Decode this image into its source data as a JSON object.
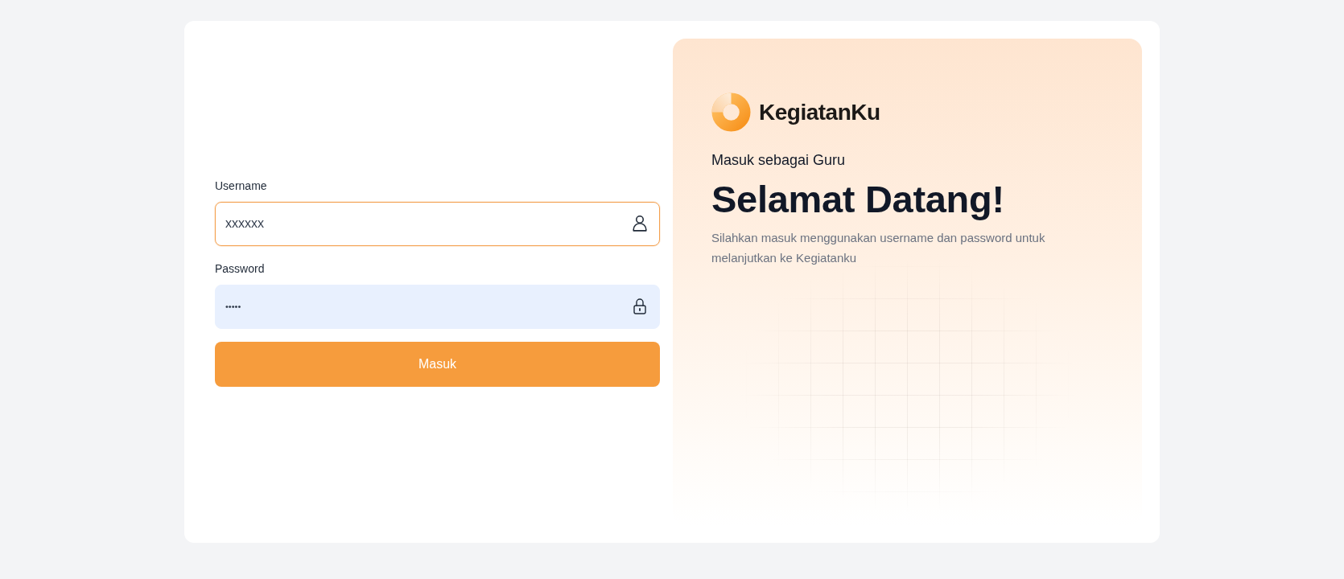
{
  "form": {
    "fields": [
      {
        "label": "Username",
        "value": "xxxxxx",
        "kind": "text",
        "focused": true,
        "autofilled": false
      },
      {
        "label": "Password",
        "value": "•••••",
        "kind": "password",
        "focused": false,
        "autofilled": true
      }
    ],
    "submit": {
      "label": "Masuk"
    }
  },
  "welcome": {
    "brand": "KegiatanKu",
    "subtitle": "Masuk sebagai Guru",
    "title": "Selamat Datang!",
    "description": "Silahkan masuk menggunakan username dan password untuk melanjutkan ke Kegiatanku"
  }
}
